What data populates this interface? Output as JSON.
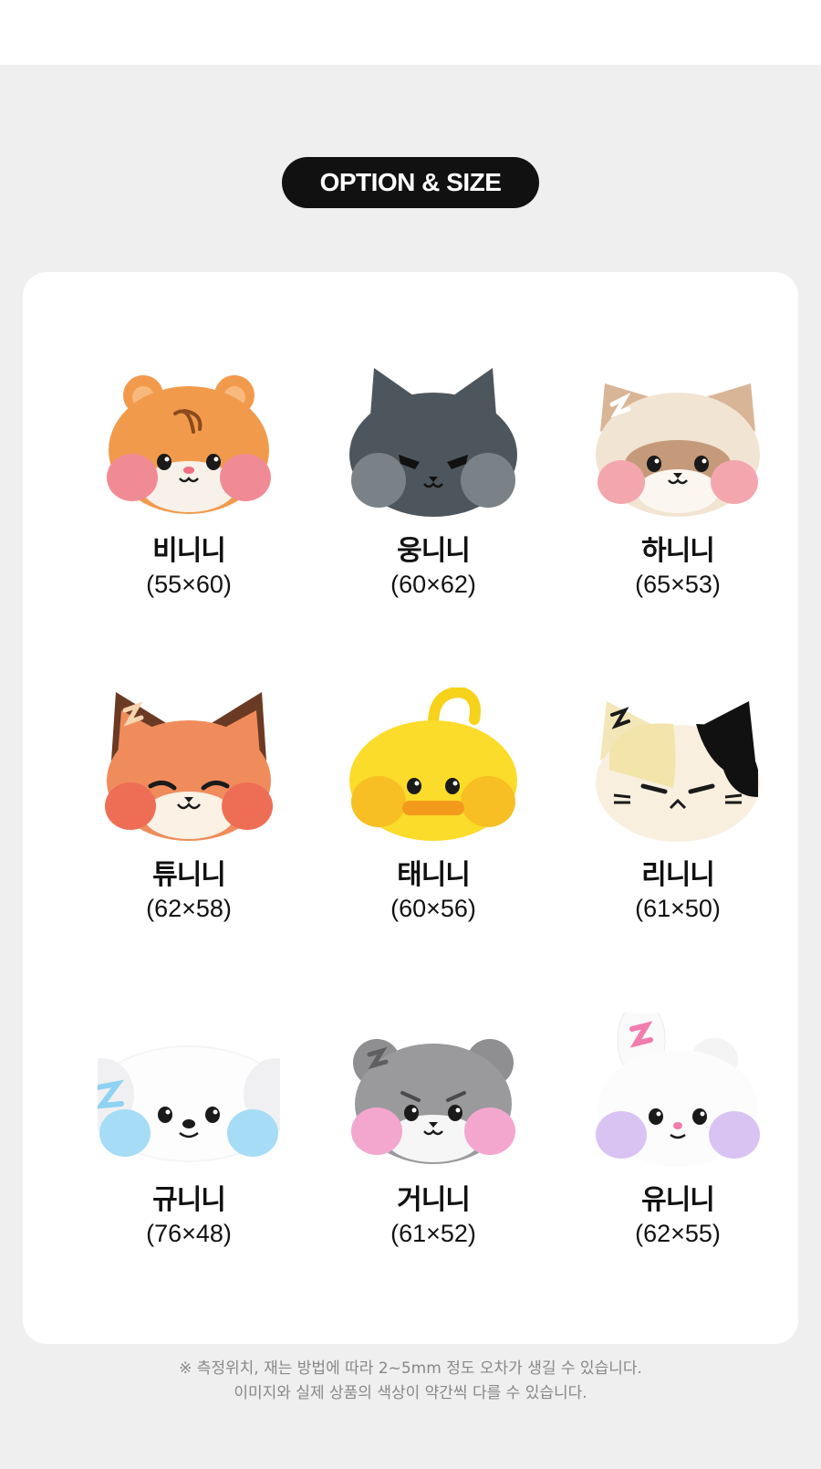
{
  "badge": "OPTION & SIZE",
  "items": [
    {
      "name": "비니니",
      "size": "(55×60)",
      "icon": "hamster-face-icon"
    },
    {
      "name": "웅니니",
      "size": "(60×62)",
      "icon": "gray-cat-face-icon"
    },
    {
      "name": "하니니",
      "size": "(65×53)",
      "icon": "raccoon-face-icon"
    },
    {
      "name": "튜니니",
      "size": "(62×58)",
      "icon": "fox-face-icon"
    },
    {
      "name": "태니니",
      "size": "(60×56)",
      "icon": "chick-face-icon"
    },
    {
      "name": "리니니",
      "size": "(61×50)",
      "icon": "calico-cat-face-icon"
    },
    {
      "name": "규니니",
      "size": "(76×48)",
      "icon": "puppy-face-icon"
    },
    {
      "name": "거니니",
      "size": "(61×52)",
      "icon": "schnauzer-face-icon"
    },
    {
      "name": "유니니",
      "size": "(62×55)",
      "icon": "bunny-face-icon"
    }
  ],
  "notes": [
    "※ 측정위치, 재는 방법에 따라 2~5mm 정도 오차가 생길 수 있습니다.",
    "이미지와 실제 상품의 색상이 약간씩 다를 수 있습니다."
  ],
  "colors": {
    "background": "#efefef",
    "card": "#ffffff",
    "badge": "#111111"
  }
}
